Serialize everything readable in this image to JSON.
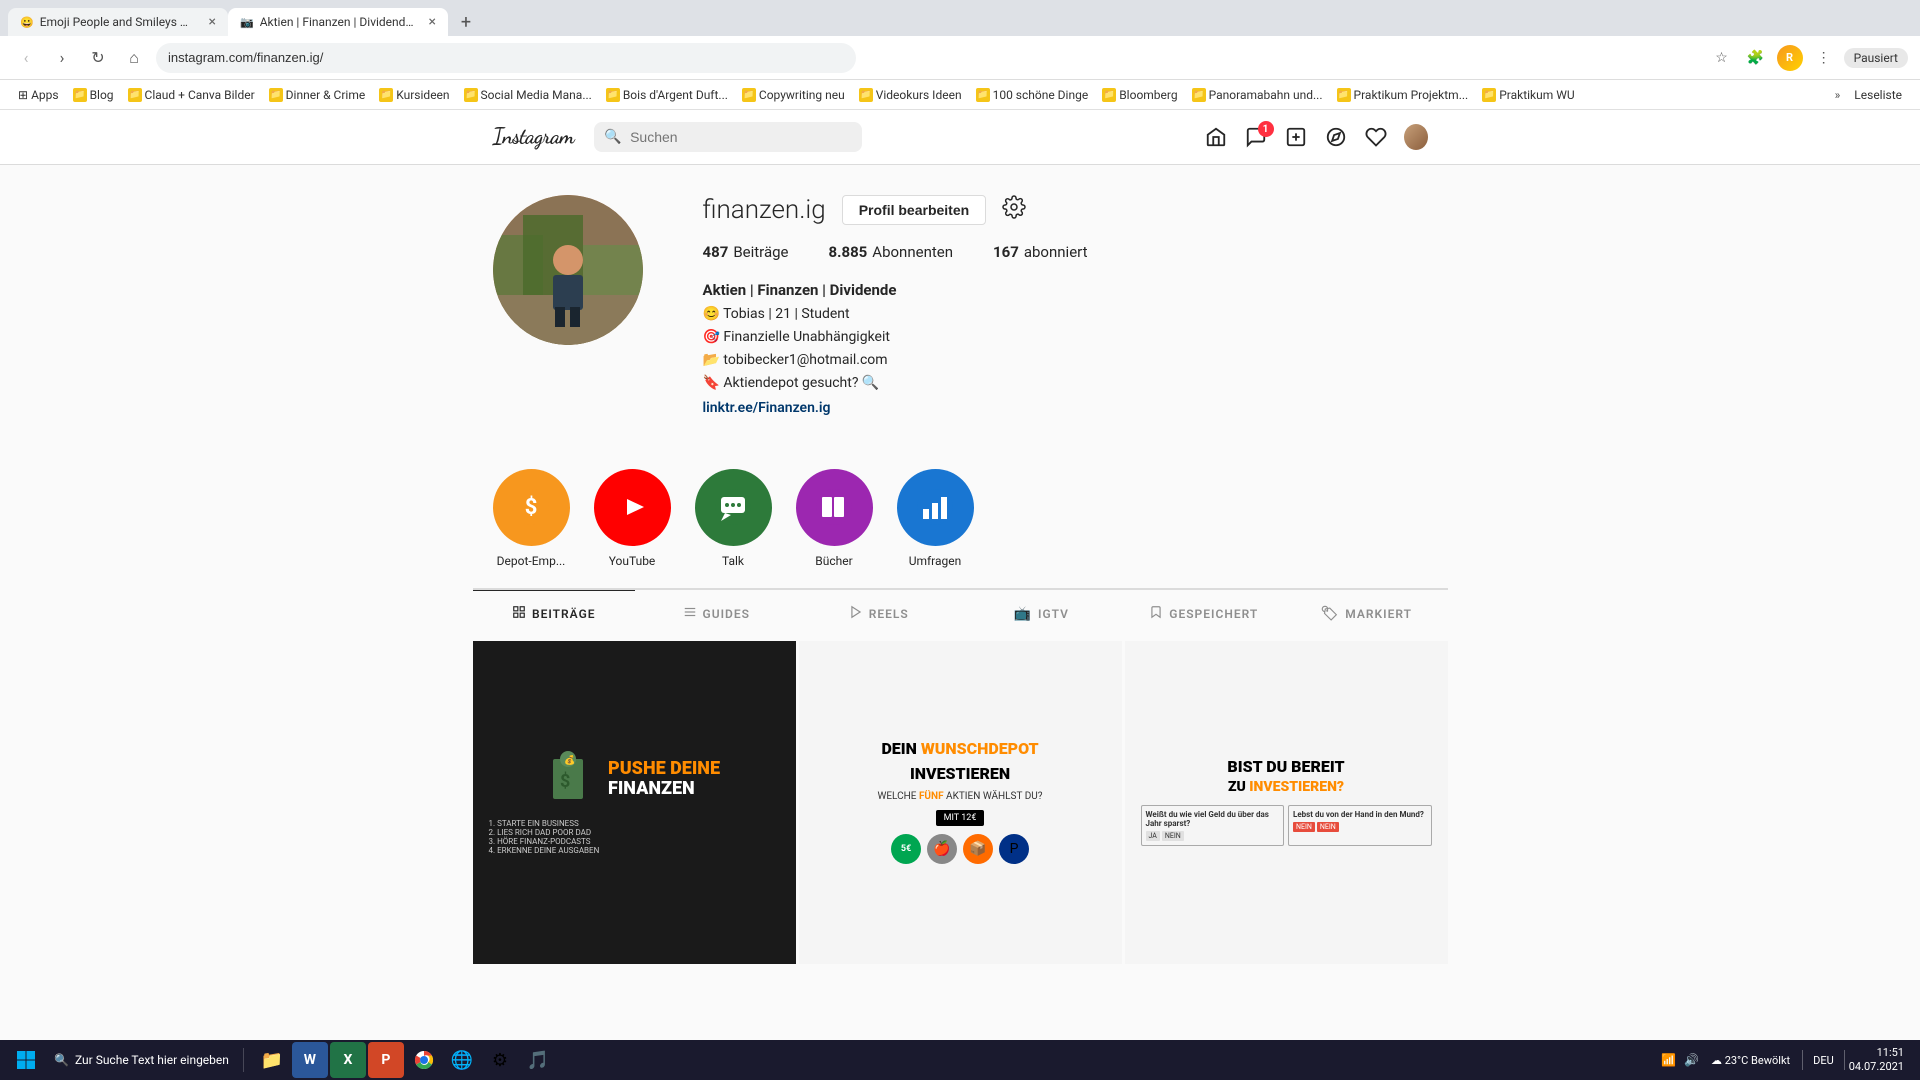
{
  "browser": {
    "tabs": [
      {
        "id": "tab1",
        "favicon": "😀",
        "title": "Emoji People and Smileys M...",
        "active": false,
        "closable": true
      },
      {
        "id": "tab2",
        "favicon": "📷",
        "title": "Aktien | Finanzen | Dividende (G...",
        "active": true,
        "closable": true
      }
    ],
    "new_tab_label": "+",
    "address": "instagram.com/finanzen.ig/",
    "nav": {
      "back": "‹",
      "forward": "›",
      "reload": "↻",
      "home": "⌂"
    },
    "search_icon": "🔍",
    "star_icon": "☆",
    "pause_label": "Pausiert",
    "profile_initials": "R"
  },
  "bookmarks": {
    "items": [
      {
        "label": "Apps",
        "icon": "grid"
      },
      {
        "label": "Blog",
        "icon": "folder"
      },
      {
        "label": "Claud + Canva Bilder",
        "icon": "folder"
      },
      {
        "label": "Dinner & Crime",
        "icon": "folder"
      },
      {
        "label": "Kursideen",
        "icon": "folder"
      },
      {
        "label": "Social Media Mana...",
        "icon": "folder"
      },
      {
        "label": "Bois d'Argent Duft...",
        "icon": "folder"
      },
      {
        "label": "Copywriting neu",
        "icon": "folder"
      },
      {
        "label": "Videokurs Ideen",
        "icon": "folder"
      },
      {
        "label": "100 schöne Dinge",
        "icon": "folder"
      },
      {
        "label": "Bloomberg",
        "icon": "folder"
      },
      {
        "label": "Panoramabahn und...",
        "icon": "folder"
      },
      {
        "label": "Praktikum Projektm...",
        "icon": "folder"
      },
      {
        "label": "Praktikum WU",
        "icon": "folder"
      }
    ],
    "more_label": "»",
    "leseliste_label": "Leseliste"
  },
  "instagram": {
    "logo": "Instagram",
    "search_placeholder": "Suchen",
    "nav_icons": {
      "home": "🏠",
      "messages_badge": "1",
      "create": "+",
      "explore": "🧭",
      "heart": "♡"
    },
    "profile": {
      "username": "finanzen.ig",
      "edit_button": "Profil bearbeiten",
      "settings_icon": "⚙",
      "stats": {
        "posts_count": "487",
        "posts_label": "Beiträge",
        "followers_count": "8.885",
        "followers_label": "Abonnenten",
        "following_count": "167",
        "following_label": "abonniert"
      },
      "bio": {
        "title": "Aktien | Finanzen | Dividende",
        "line1": "😊 Tobias | 21 | Student",
        "line2": "🎯 Finanzielle Unabhängigkeit",
        "line3": "📂 tobibecker1@hotmail.com",
        "line4": "🔖 Aktiendepot gesucht? 🔍",
        "link": "linktr.ee/Finanzen.ig"
      }
    },
    "highlights": [
      {
        "id": "depot",
        "label": "Depot-Emp...",
        "icon": "$",
        "color": "#f7971e"
      },
      {
        "id": "youtube",
        "label": "YouTube",
        "icon": "▶",
        "color": "#ff0000"
      },
      {
        "id": "talk",
        "label": "Talk",
        "icon": "💬",
        "color": "#2d7a3a"
      },
      {
        "id": "buecher",
        "label": "Bücher",
        "icon": "📖",
        "color": "#9c27b0"
      },
      {
        "id": "umfragen",
        "label": "Umfragen",
        "icon": "📊",
        "color": "#1976d2"
      }
    ],
    "tabs": [
      {
        "id": "beitraege",
        "icon": "⊞",
        "label": "BEITRÄGE",
        "active": true
      },
      {
        "id": "guides",
        "icon": "≡",
        "label": "GUIDES",
        "active": false
      },
      {
        "id": "reels",
        "icon": "▷",
        "label": "REELS",
        "active": false
      },
      {
        "id": "igtv",
        "icon": "📺",
        "label": "IGTV",
        "active": false
      },
      {
        "id": "gespeichert",
        "icon": "🔖",
        "label": "GESPEICHERT",
        "active": false
      },
      {
        "id": "markiert",
        "icon": "🏷",
        "label": "MARKIERT",
        "active": false
      }
    ],
    "posts": [
      {
        "id": "post1",
        "type": "text",
        "bg": "#1a1a1a",
        "title_line1": "PUSHE DEINE",
        "title_line2": "FINANZEN",
        "title_color": "#ff8c00"
      },
      {
        "id": "post2",
        "type": "text",
        "bg": "#f5f5f5",
        "title_line1": "DEIN WUNSCHDEPOT",
        "title_line2": "INVESTIEREN",
        "title_color": "#ff8c00"
      },
      {
        "id": "post3",
        "type": "text",
        "bg": "#f5f5f5",
        "title_line1": "BIST DU BEREIT",
        "title_line2": "ZU INVESTIEREN?",
        "title_color": "#ff8c00"
      }
    ]
  },
  "taskbar": {
    "start_icon": "⊞",
    "search_placeholder": "Zur Suche Text hier eingeben",
    "search_icon": "🔍",
    "apps": [
      {
        "id": "file-explorer",
        "icon": "📁"
      },
      {
        "id": "word",
        "icon": "W"
      },
      {
        "id": "excel",
        "icon": "X"
      },
      {
        "id": "powerpoint",
        "icon": "P"
      },
      {
        "id": "chrome",
        "icon": "🌐"
      },
      {
        "id": "edge",
        "icon": "e"
      },
      {
        "id": "settings",
        "icon": "⚙"
      },
      {
        "id": "music",
        "icon": "🎵"
      }
    ],
    "tray": {
      "weather": "23°C Bewölkt",
      "language": "DEU",
      "time": "11:51",
      "date": "04.07.2021"
    }
  }
}
